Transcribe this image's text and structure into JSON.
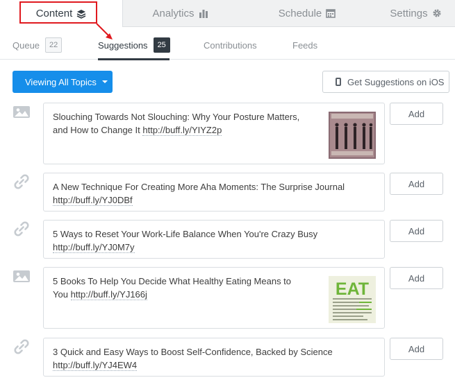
{
  "top_tabs": [
    {
      "label": "Content",
      "icon": "layers-icon",
      "active": true
    },
    {
      "label": "Analytics",
      "icon": "bar-chart-icon",
      "active": false
    },
    {
      "label": "Schedule",
      "icon": "calendar-icon",
      "active": false
    },
    {
      "label": "Settings",
      "icon": "gear-icon",
      "active": false
    }
  ],
  "sub_tabs": [
    {
      "label": "Queue",
      "count": "22"
    },
    {
      "label": "Suggestions",
      "count": "25"
    },
    {
      "label": "Contributions"
    },
    {
      "label": "Feeds"
    }
  ],
  "actions": {
    "topics_label": "Viewing All Topics",
    "ios_label": "Get Suggestions on iOS"
  },
  "suggestions": [
    {
      "type": "image",
      "text": "Slouching Towards Not Slouching: Why Your Posture Matters, and How to Change It",
      "link": "http://buff.ly/YIYZ2p",
      "add_label": "Add"
    },
    {
      "type": "link",
      "text": "A New Technique For Creating More Aha Moments: The Surprise Journal",
      "link": "http://buff.ly/YJ0DBf",
      "add_label": "Add"
    },
    {
      "type": "link",
      "text": "5 Ways to Reset Your Work-Life Balance When You're Crazy Busy",
      "link": "http://buff.ly/YJ0M7y",
      "add_label": "Add"
    },
    {
      "type": "image",
      "text": "5 Books To Help You Decide What Healthy Eating Means to You",
      "link": "http://buff.ly/YJ166j",
      "add_label": "Add",
      "thumb_word": "EAT"
    },
    {
      "type": "link",
      "text": "3 Quick and Easy Ways to Boost Self-Confidence, Backed by Science",
      "link": "http://buff.ly/YJ4EW4",
      "add_label": "Add"
    }
  ],
  "colors": {
    "accent": "#168eea",
    "annotation": "#e0191f",
    "active_badge": "#323b43"
  }
}
